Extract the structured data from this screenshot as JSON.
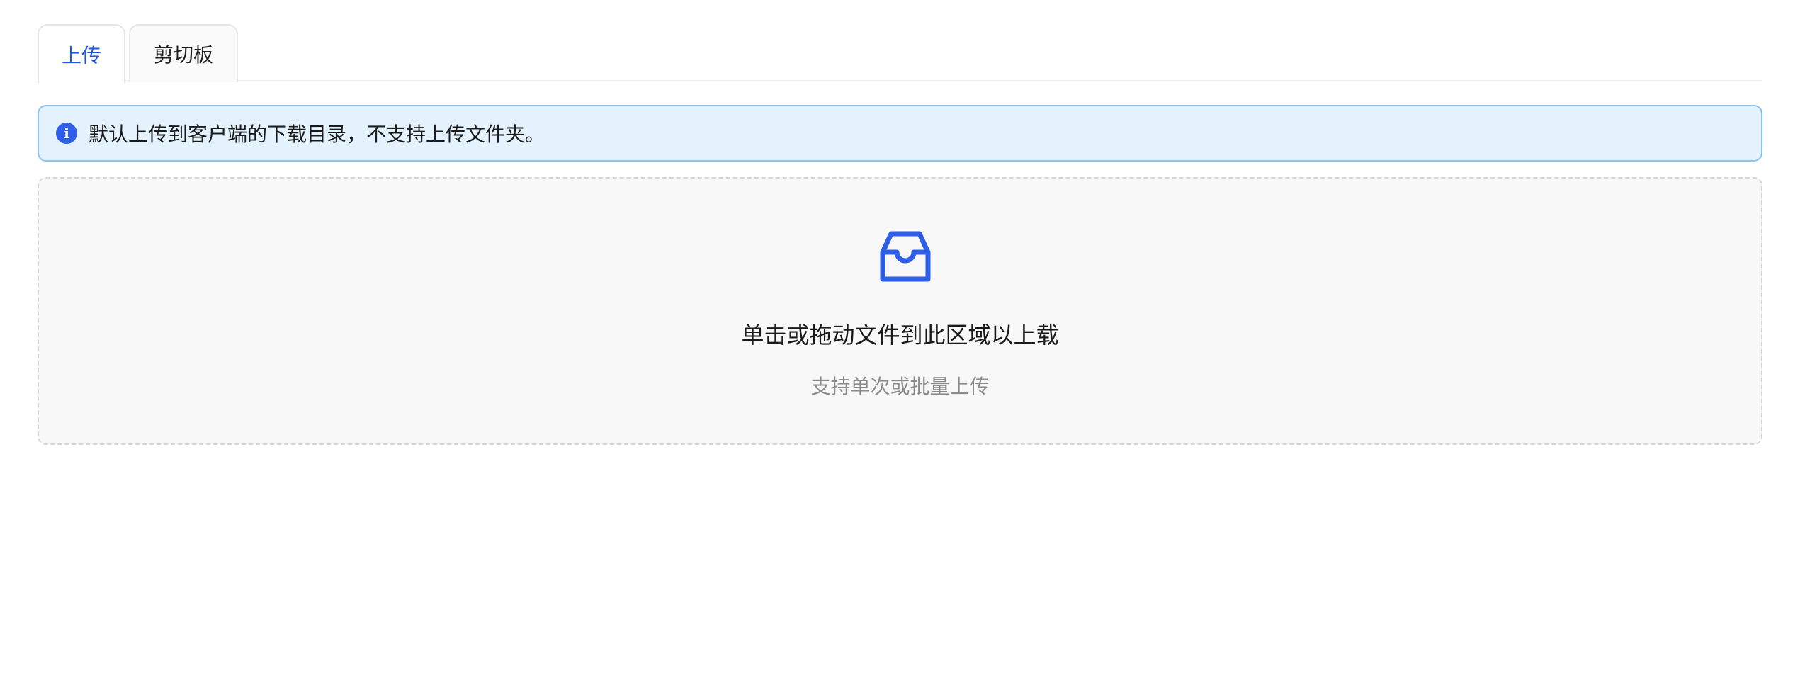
{
  "tabs": [
    {
      "label": "上传",
      "active": true
    },
    {
      "label": "剪切板",
      "active": false
    }
  ],
  "alert": {
    "icon": "info-icon",
    "text": "默认上传到客户端的下载目录，不支持上传文件夹。"
  },
  "upload": {
    "icon": "inbox-icon",
    "title": "单击或拖动文件到此区域以上载",
    "hint": "支持单次或批量上传"
  },
  "colors": {
    "accent": "#2f5fe8",
    "alert_bg": "#e3f2fd",
    "alert_border": "#8cc3f0"
  }
}
